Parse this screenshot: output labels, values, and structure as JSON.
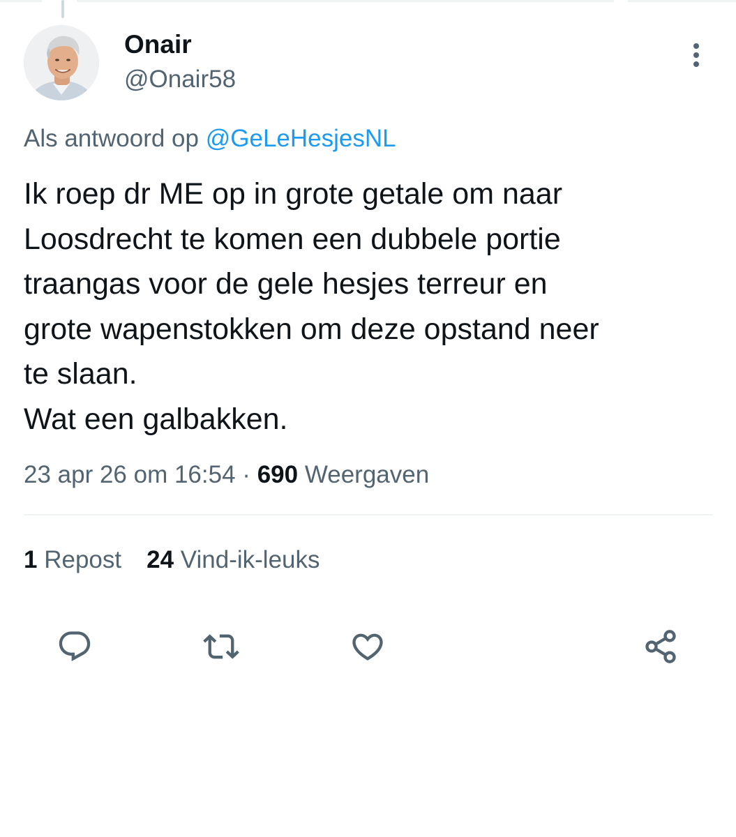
{
  "author": {
    "display_name": "Onair",
    "handle": "@Onair58",
    "avatar": "avatar-photo"
  },
  "header": {
    "more_icon": "more-vertical-icon"
  },
  "reply": {
    "prefix": "Als antwoord op",
    "mention": "@GeLeHesjesNL"
  },
  "tweet": {
    "lines": [
      "Ik roep dr ME op in grote getale om naar",
      "Loosdrecht te komen een dubbele portie",
      "traangas voor de gele hesjes terreur en",
      "grote wapenstokken om deze opstand neer",
      "te slaan.",
      "Wat een galbakken."
    ]
  },
  "meta": {
    "date": "23 apr 26 om 16:54",
    "separator": "·",
    "views_count": "690",
    "views_label": "Weergaven"
  },
  "stats": {
    "reposts_count": "1",
    "reposts_label": "Repost",
    "likes_count": "24",
    "likes_label": "Vind-ik-leuks"
  },
  "actions": {
    "reply_icon": "reply-icon",
    "repost_icon": "repost-icon",
    "like_icon": "like-icon",
    "share_icon": "share-icon"
  },
  "colors": {
    "text_primary": "#0f1419",
    "text_secondary": "#536471",
    "link": "#1d9bf0",
    "divider": "#eff3f4"
  }
}
